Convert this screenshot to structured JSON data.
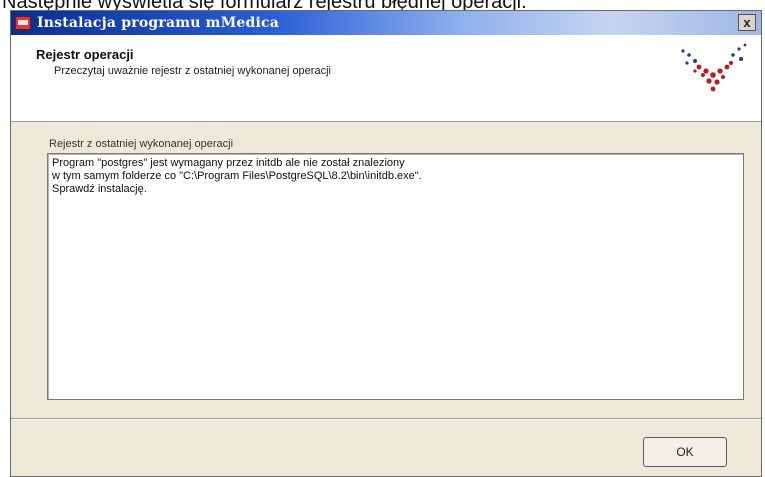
{
  "caption": "Następnie wyświetla się formularz rejestru błędnej operacji.",
  "window": {
    "title": "Instalacja programu mMedica",
    "icon": "app-icon",
    "close_label": "x"
  },
  "header": {
    "title": "Rejestr operacji",
    "subtitle": "Przeczytaj uważnie rejestr z ostatniej wykonanej operacji",
    "logo": "dot-logo"
  },
  "main": {
    "log_label": "Rejestr z ostatniej wykonanej operacji",
    "log_lines": [
      "Program \"postgres\" jest wymagany przez initdb ale nie został znaleziony",
      "w tym samym folderze co \"C:\\Program Files\\PostgreSQL\\8.2\\bin\\initdb.exe\".",
      "Sprawdź instalację."
    ]
  },
  "footer": {
    "ok_label": "OK"
  },
  "colors": {
    "titlebar_start": "#0a2e8f",
    "titlebar_end": "#c6d4f0",
    "dialog_bg": "#ece9d8",
    "logo_red": "#c4161c",
    "logo_blue": "#1c3c8c"
  }
}
